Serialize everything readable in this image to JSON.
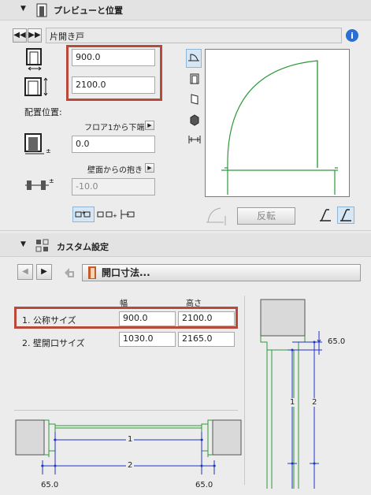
{
  "preview": {
    "title": "プレビューと位置",
    "name_value": "片開き戸",
    "width_value": "900.0",
    "height_value": "2100.0",
    "placement_label": "配置位置:",
    "floor_label": "フロア1から下端",
    "floor_value": "0.0",
    "wall_label": "壁面からの抱き",
    "wall_value": "-10.0",
    "flip_label": "反転"
  },
  "custom": {
    "title": "カスタム設定",
    "dropdown_label": "開口寸法...",
    "col_width": "幅",
    "col_height": "高さ",
    "rows": [
      {
        "label": "1. 公称サイズ",
        "w": "900.0",
        "h": "2100.0"
      },
      {
        "label": "2. 壁開口サイズ",
        "w": "1030.0",
        "h": "2165.0"
      }
    ],
    "diagram": {
      "right_dim": "65.0",
      "v_label_1": "1",
      "v_label_2": "2",
      "h_label_1": "1",
      "h_label_2": "2",
      "left_bottom_dim": "65.0",
      "right_bottom_dim": "65.0"
    }
  },
  "colors": {
    "highlight": "#b94a3b",
    "line_green": "#2e9a3a",
    "dim_blue": "#1f33c9",
    "info_blue": "#2a6fd1"
  }
}
